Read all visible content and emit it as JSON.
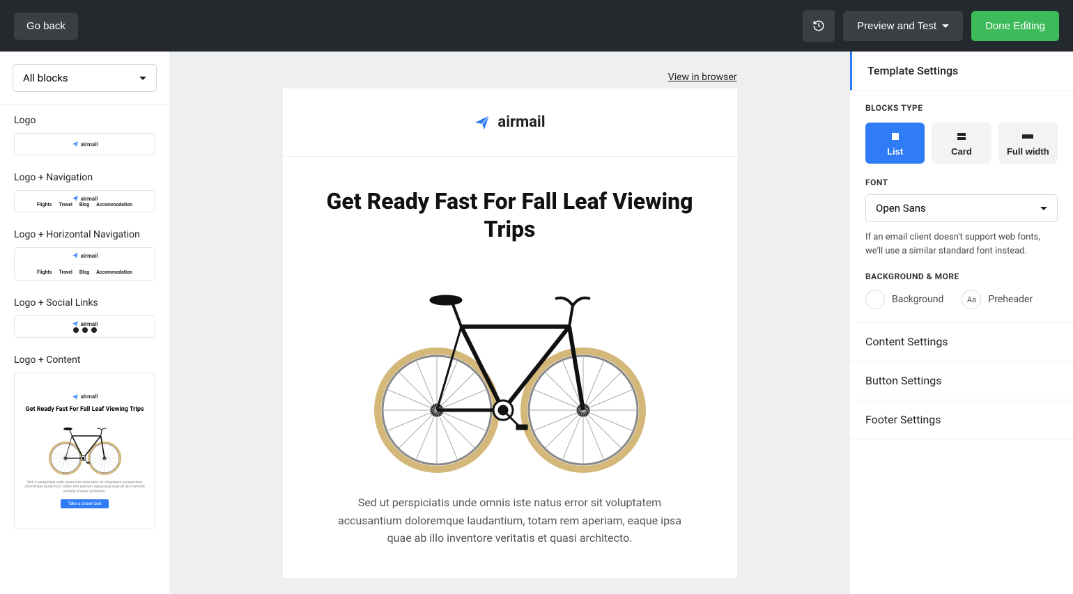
{
  "topbar": {
    "go_back": "Go back",
    "preview_test": "Preview and Test",
    "done_editing": "Done Editing"
  },
  "left": {
    "filter_label": "All blocks",
    "blocks": [
      {
        "label": "Logo"
      },
      {
        "label": "Logo + Navigation"
      },
      {
        "label": "Logo + Horizontal Navigation"
      },
      {
        "label": "Logo + Social Links"
      },
      {
        "label": "Logo + Content"
      }
    ],
    "mini_brand": "airmail",
    "mini_nav_items": [
      "Flights",
      "Travel",
      "Blog",
      "Accommodation"
    ],
    "mini_content_title": "Get Ready Fast For Fall Leaf Viewing Trips",
    "mini_content_body": "Sed ut perspiciatis unde omnis iste natus error sit voluptatem accusantium doloremque laudantium, totam rem aperiam, eaque ipsa quae ab illo inventore veritatis et quasi architecto.",
    "mini_btn": "Take a closer look"
  },
  "canvas": {
    "view_browser": "View in browser",
    "brand": "airmail",
    "headline": "Get Ready Fast For Fall Leaf Viewing Trips",
    "paragraph": "Sed ut perspiciatis unde omnis iste natus error sit voluptatem accusantium doloremque laudantium, totam rem aperiam, eaque ipsa quae ab illo inventore veritatis et quasi architecto."
  },
  "right": {
    "tabs": {
      "template": "Template Settings",
      "content": "Content Settings",
      "button": "Button Settings",
      "footer": "Footer Settings"
    },
    "blocks_type_label": "BLOCKS TYPE",
    "types": [
      {
        "name": "List"
      },
      {
        "name": "Card"
      },
      {
        "name": "Full width"
      }
    ],
    "font_label": "FONT",
    "font_value": "Open Sans",
    "font_note": "If an email client doesn't support web fonts, we'll use a similar standard font instead.",
    "bgmore_label": "BACKGROUND & MORE",
    "bgmore": [
      {
        "label": "Background",
        "glyph": ""
      },
      {
        "label": "Preheader",
        "glyph": "Aa"
      }
    ]
  },
  "colors": {
    "accent": "#2f7cf6",
    "success": "#3dbb5a"
  }
}
